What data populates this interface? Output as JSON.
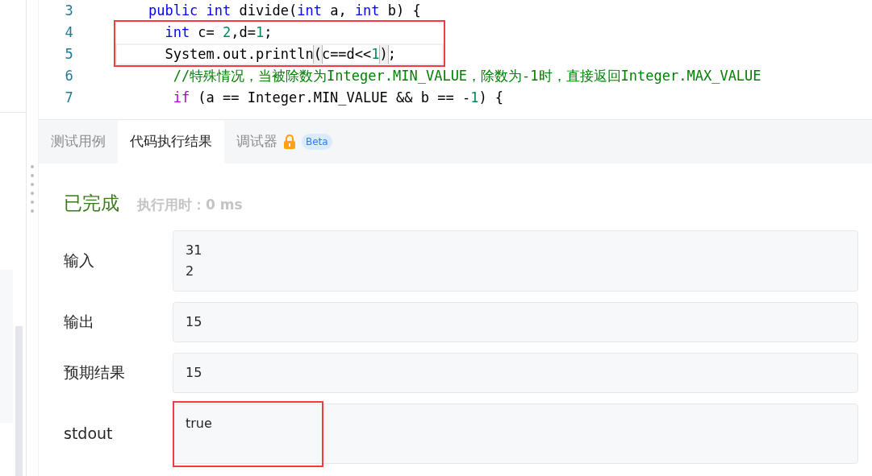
{
  "editor": {
    "blocks": [
      {
        "kind": "plain",
        "lines": [
          {
            "number": "3",
            "current": false,
            "tokens": [
              {
                "kind": "keyword",
                "text": "    public"
              },
              {
                "kind": "keyword",
                "text": " int"
              },
              {
                "kind": "plain",
                "text": " divide("
              },
              {
                "kind": "keyword",
                "text": "int"
              },
              {
                "kind": "plain",
                "text": " a, "
              },
              {
                "kind": "keyword",
                "text": "int"
              },
              {
                "kind": "plain",
                "text": " b) {"
              }
            ]
          }
        ]
      },
      {
        "kind": "framed",
        "lines": [
          {
            "number": "4",
            "current": false,
            "tokens": [
              {
                "kind": "keyword",
                "text": "      int"
              },
              {
                "kind": "plain",
                "text": " c= "
              },
              {
                "kind": "number",
                "text": "2"
              },
              {
                "kind": "plain",
                "text": ",d="
              },
              {
                "kind": "number",
                "text": "1"
              },
              {
                "kind": "plain",
                "text": ";"
              }
            ]
          },
          {
            "number": "5",
            "current": true,
            "tokens": [
              {
                "kind": "plain",
                "text": "      System.out.println"
              },
              {
                "kind": "bracket",
                "text": "("
              },
              {
                "kind": "plain",
                "text": "c==d<<"
              },
              {
                "kind": "number",
                "text": "1"
              },
              {
                "kind": "bracket",
                "text": ")"
              },
              {
                "kind": "plain",
                "text": ";"
              }
            ]
          }
        ]
      },
      {
        "kind": "plain",
        "lines": [
          {
            "number": "6",
            "current": false,
            "tokens": [
              {
                "kind": "comment",
                "text": "       //特殊情况，当被除数为Integer.MIN_VALUE，除数为-1时，直接返回Integer.MAX_VALUE"
              }
            ]
          },
          {
            "number": "7",
            "current": false,
            "tokens": [
              {
                "kind": "control",
                "text": "       if"
              },
              {
                "kind": "plain",
                "text": " (a == Integer.MIN_VALUE && b == -"
              },
              {
                "kind": "number",
                "text": "1"
              },
              {
                "kind": "plain",
                "text": ") {"
              }
            ]
          }
        ]
      }
    ]
  },
  "tabs": [
    {
      "label": "测试用例",
      "selected": false
    },
    {
      "label": "代码执行结果",
      "selected": true
    },
    {
      "label": "调试器",
      "selected": false,
      "locked": true,
      "badge": "Beta"
    }
  ],
  "result": {
    "status": "已完成",
    "runtime_label": "执行用时：",
    "runtime": "0 ms",
    "rows": [
      {
        "label": "输入",
        "lines": [
          "31",
          "2"
        ],
        "boxed": false
      },
      {
        "label": "输出",
        "lines": [
          "15"
        ],
        "boxed": false
      },
      {
        "label": "预期结果",
        "lines": [
          "15"
        ],
        "boxed": false
      },
      {
        "label": "stdout",
        "lines": [
          "true"
        ],
        "boxed": true
      }
    ]
  }
}
